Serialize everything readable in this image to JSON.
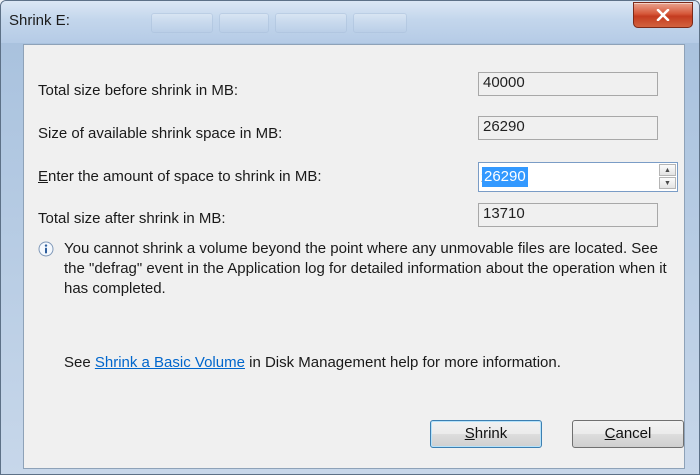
{
  "window": {
    "title": "Shrink E:",
    "close_glyph": "X"
  },
  "fields": {
    "total_before": {
      "label": "Total size before shrink in MB:",
      "value": "40000"
    },
    "available": {
      "label": "Size of available shrink space in MB:",
      "value": "26290"
    },
    "amount": {
      "label_accel": "E",
      "label_rest": "nter the amount of space to shrink in MB:",
      "value": "26290"
    },
    "total_after": {
      "label": "Total size after shrink in MB:",
      "value": "13710"
    }
  },
  "info": {
    "icon": "info-icon",
    "text": "You cannot shrink a volume beyond the point where any unmovable files are located. See the \"defrag\" event in the Application log for detailed information about the operation when it has completed."
  },
  "help": {
    "prefix": "See ",
    "link_text": "Shrink a Basic Volume",
    "suffix": " in Disk Management help for more information."
  },
  "buttons": {
    "shrink": {
      "accel": "S",
      "rest": "hrink"
    },
    "cancel": {
      "accel": "C",
      "rest": "ancel"
    }
  },
  "colors": {
    "selection": "#3399ff",
    "link": "#0066cc",
    "close_button": "#c43c20"
  }
}
